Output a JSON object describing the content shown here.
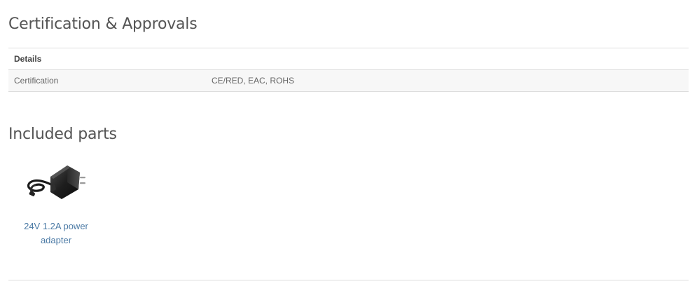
{
  "certification": {
    "title": "Certification & Approvals",
    "table": {
      "header": "Details",
      "rows": [
        {
          "label": "Certification",
          "value": "CE/RED, EAC, ROHS"
        }
      ]
    }
  },
  "included_parts": {
    "title": "Included parts",
    "items": [
      {
        "name": "24V 1.2A power adapter",
        "icon": "power-adapter-image"
      }
    ]
  },
  "colors": {
    "link": "#4b7aa5",
    "heading": "#555555",
    "row_background": "#f7f7f7",
    "border": "#dddddd"
  }
}
